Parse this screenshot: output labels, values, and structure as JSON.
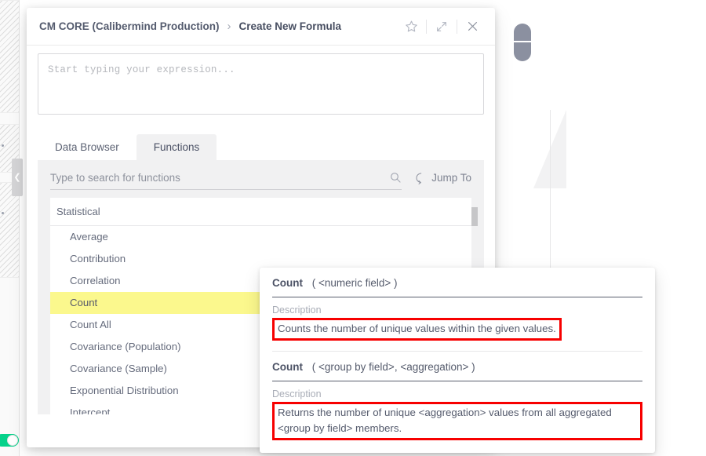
{
  "background": {
    "collapse_handle_icon": "chevron-left-icon",
    "toggle_state": "on",
    "toggle_color": "#05d28a"
  },
  "modal": {
    "breadcrumb": {
      "root": "CM CORE (Calibermind Production)",
      "separator": "›",
      "current": "Create New Formula"
    },
    "header_icons": [
      {
        "name": "favorite-star-icon",
        "glyph": "star"
      },
      {
        "name": "expand-icon",
        "glyph": "expand"
      },
      {
        "name": "close-icon",
        "glyph": "close"
      }
    ],
    "expression_editor": {
      "value": "",
      "placeholder": "Start typing your expression..."
    },
    "tabs": [
      {
        "label": "Data Browser",
        "active": false
      },
      {
        "label": "Functions",
        "active": true
      }
    ],
    "search": {
      "value": "",
      "placeholder": "Type to search for functions",
      "search_icon": "search-icon"
    },
    "jump_to": {
      "label": "Jump To",
      "icon": "jump-to-arrow-icon"
    },
    "function_list": {
      "group_header": "Statistical",
      "items": [
        {
          "label": "Average",
          "selected": false
        },
        {
          "label": "Contribution",
          "selected": false
        },
        {
          "label": "Correlation",
          "selected": false
        },
        {
          "label": "Count",
          "selected": true
        },
        {
          "label": "Count All",
          "selected": false
        },
        {
          "label": "Covariance (Population)",
          "selected": false
        },
        {
          "label": "Covariance (Sample)",
          "selected": false
        },
        {
          "label": "Exponential Distribution",
          "selected": false
        },
        {
          "label": "Intercept",
          "selected": false
        }
      ],
      "highlight_color": "#fbf88d"
    }
  },
  "tooltip": {
    "entries": [
      {
        "name": "Count",
        "args": "( <numeric field> )",
        "description_label": "Description",
        "description": "Counts the number of unique values within the given values.",
        "annotated": true
      },
      {
        "name": "Count",
        "args": "( <group by field>, <aggregation> )",
        "description_label": "Description",
        "description": "Returns the number of unique <aggregation> values from all aggregated <group by field> members.",
        "annotated": true
      }
    ],
    "annotation_color": "#f70000"
  }
}
